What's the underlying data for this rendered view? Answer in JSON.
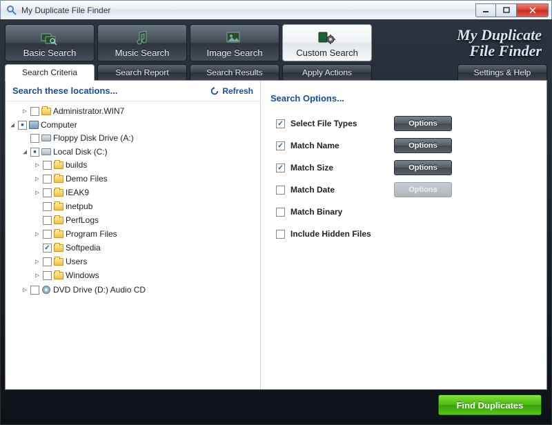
{
  "window": {
    "title": "My Duplicate File Finder"
  },
  "brand": {
    "line1": "My Duplicate",
    "line2": "File Finder"
  },
  "toolbar": [
    {
      "label": "Basic Search",
      "icon": "folders"
    },
    {
      "label": "Music Search",
      "icon": "music"
    },
    {
      "label": "Image Search",
      "icon": "image"
    },
    {
      "label": "Custom Search",
      "icon": "gear",
      "active": true
    }
  ],
  "subtabs": [
    {
      "label": "Search Criteria",
      "active": true
    },
    {
      "label": "Search Report"
    },
    {
      "label": "Search Results"
    },
    {
      "label": "Apply Actions"
    }
  ],
  "settings_tab": "Settings & Help",
  "left": {
    "header": "Search these locations...",
    "refresh": "Refresh"
  },
  "tree": {
    "root1": "Administrator.WIN7",
    "root2": "Computer",
    "drives": {
      "floppy": "Floppy Disk Drive (A:)",
      "local": "Local Disk (C:)",
      "dvd": "DVD Drive (D:) Audio CD"
    },
    "folders": [
      "builds",
      "Demo Files",
      "IEAK9",
      "inetpub",
      "PerfLogs",
      "Program Files",
      "Softpedia",
      "Users",
      "Windows"
    ]
  },
  "right": {
    "header": "Search Options...",
    "options": [
      {
        "label": "Select File Types",
        "checked": true,
        "button": "Options",
        "enabled": true
      },
      {
        "label": "Match Name",
        "checked": true,
        "button": "Options",
        "enabled": true
      },
      {
        "label": "Match Size",
        "checked": true,
        "button": "Options",
        "enabled": true
      },
      {
        "label": "Match Date",
        "checked": false,
        "button": "Options",
        "enabled": false
      },
      {
        "label": "Match Binary",
        "checked": false
      },
      {
        "label": "Include Hidden Files",
        "checked": false
      }
    ]
  },
  "footer": {
    "find": "Find Duplicates"
  }
}
